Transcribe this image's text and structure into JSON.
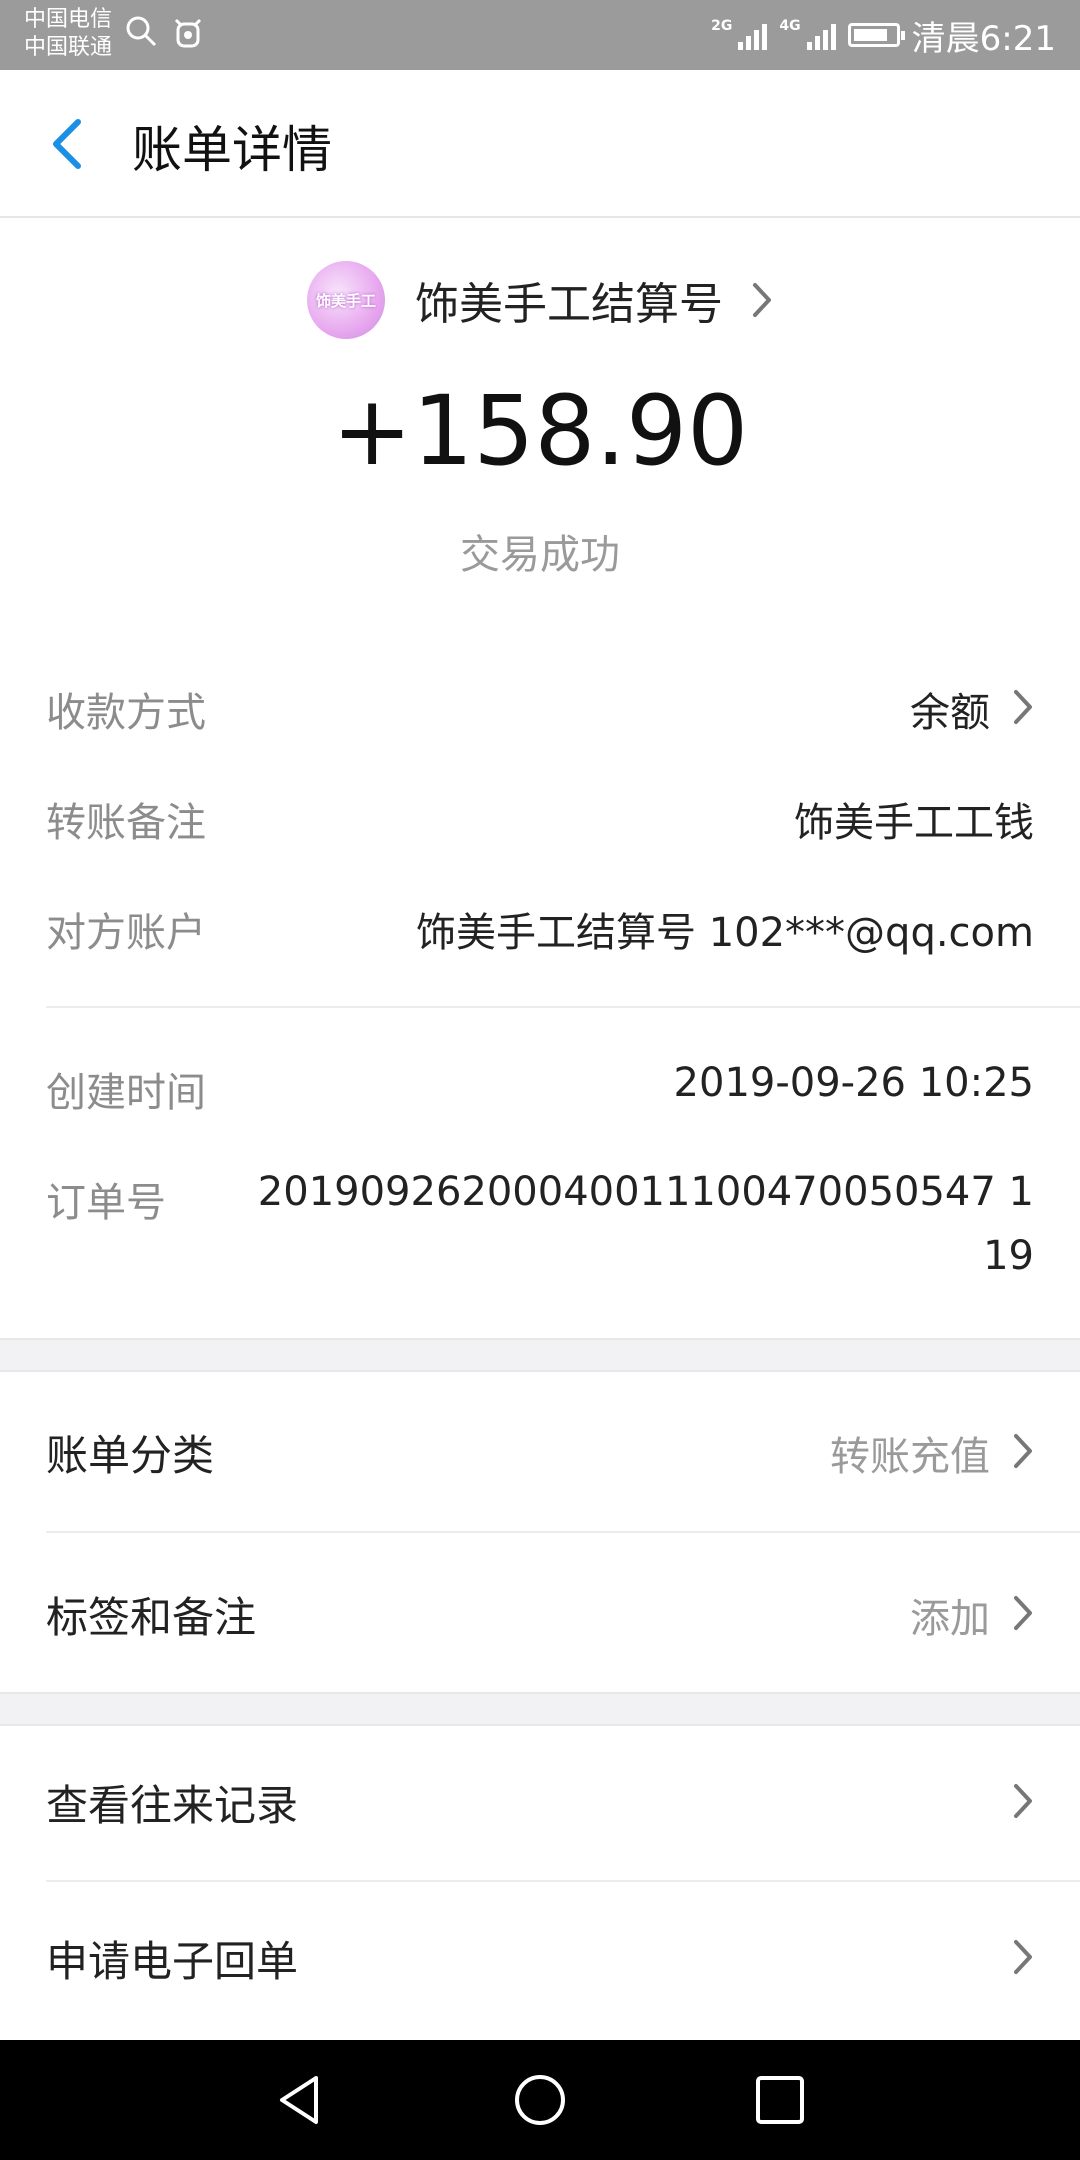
{
  "status_bar": {
    "carrier_1": "中国电信",
    "carrier_2": "中国联通",
    "network_1": "2G",
    "network_2": "4G",
    "time": "清晨6:21"
  },
  "header": {
    "back_icon": "chevron-left-icon",
    "title": "账单详情",
    "accent_color": "#1a8fe3"
  },
  "summary": {
    "avatar_text": "饰美手工",
    "payee_name": "饰美手工结算号",
    "amount": "+158.90",
    "status": "交易成功"
  },
  "details": {
    "payment_method": {
      "label": "收款方式",
      "value": "余额"
    },
    "transfer_note": {
      "label": "转账备注",
      "value": "饰美手工工钱"
    },
    "counterparty": {
      "label": "对方账户",
      "value": "饰美手工结算号 102***@qq.com"
    },
    "created_time": {
      "label": "创建时间",
      "value": "2019-09-26 10:25"
    },
    "order_no": {
      "label": "订单号",
      "value_line1": "20190926200040011100470050547 1",
      "value_line2": "19"
    }
  },
  "list": {
    "category": {
      "label": "账单分类",
      "value": "转账充值"
    },
    "tags": {
      "label": "标签和备注",
      "value": "添加"
    },
    "history": {
      "label": "查看往来记录"
    },
    "receipt": {
      "label": "申请电子回单"
    }
  }
}
